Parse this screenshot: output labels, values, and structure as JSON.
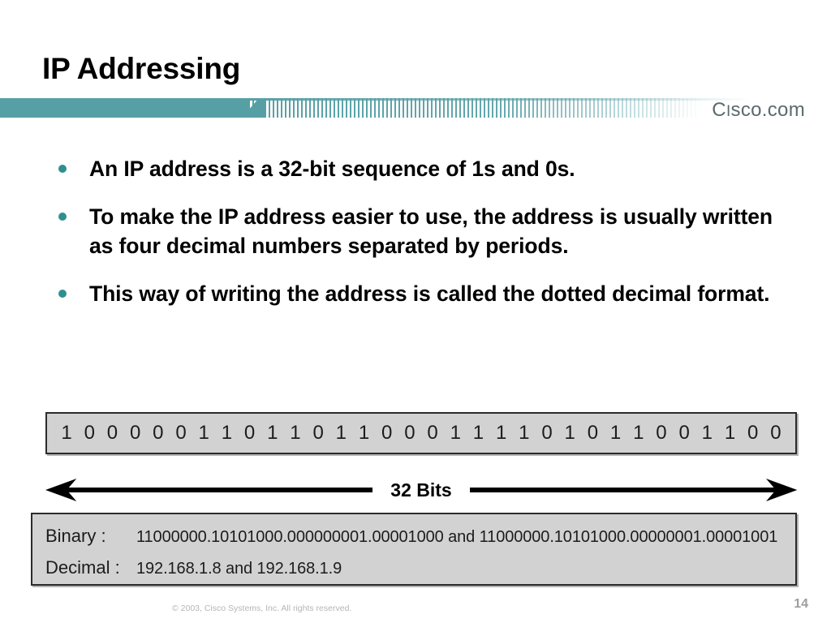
{
  "slide": {
    "title": "IP Addressing",
    "brand": {
      "prefix": "C",
      "smallcap": "I",
      "suffix": "sco.com"
    },
    "accent_color": "#56a0a5",
    "bullet_color": "#2f8f8f"
  },
  "bullets": [
    {
      "text": "An IP address is a 32-bit sequence of 1s and 0s."
    },
    {
      "text": "To make the IP address easier to use, the address is usually written as four decimal numbers separated by periods."
    },
    {
      "text": "This way of writing the address is called the dotted decimal format."
    }
  ],
  "bit_sequence": {
    "bits": [
      "1",
      "0",
      "0",
      "0",
      "0",
      "0",
      "1",
      "1",
      "0",
      "1",
      "1",
      "0",
      "1",
      "1",
      "0",
      "0",
      "0",
      "1",
      "1",
      "1",
      "1",
      "0",
      "1",
      "0",
      "1",
      "1",
      "0",
      "0",
      "1",
      "1",
      "0",
      "0"
    ],
    "count": 32
  },
  "arrow": {
    "label": "32 Bits"
  },
  "detail": {
    "rows": [
      {
        "label": "Binary :",
        "value": "11000000.10101000.000000001.00001000 and 11000000.10101000.00000001.00001001"
      },
      {
        "label": "Decimal :",
        "value": "192.168.1.8 and 192.168.1.9"
      }
    ]
  },
  "footer": {
    "copyright": "© 2003, Cisco Systems, Inc. All rights reserved.",
    "page_number": "14"
  }
}
